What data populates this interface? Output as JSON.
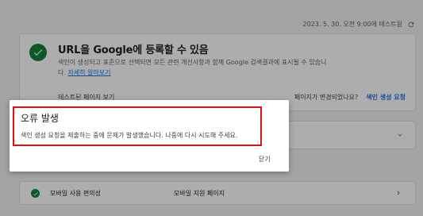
{
  "header": {
    "timestamp": "2023. 5. 30. 오전 9:00에 테스트됨"
  },
  "inspection_card": {
    "title": "URL을 Google에 등록할 수 있음",
    "description": "색인이 생성되고 표준으로 선택되면 모든 관련 개선사항과 함께 Google 검색결과에 표시될 수 있습니다.",
    "learn_more": "자세히 알아보기",
    "test_page_link": "테스트된 페이지 보기",
    "page_changed_question": "페이지가 변경되었나요?",
    "request_indexing": "색인 생성 요청",
    "status_color": "#188038"
  },
  "mobile_row": {
    "label": "모바일 사용 편의성",
    "value": "모바일 지원 페이지"
  },
  "dialog": {
    "title": "오류 발생",
    "message": "색인 생성 요청을 제출하는 중에 문제가 발생했습니다. 나중에 다시 시도해 주세요.",
    "close_label": "닫기",
    "highlight_color": "#e01010"
  }
}
